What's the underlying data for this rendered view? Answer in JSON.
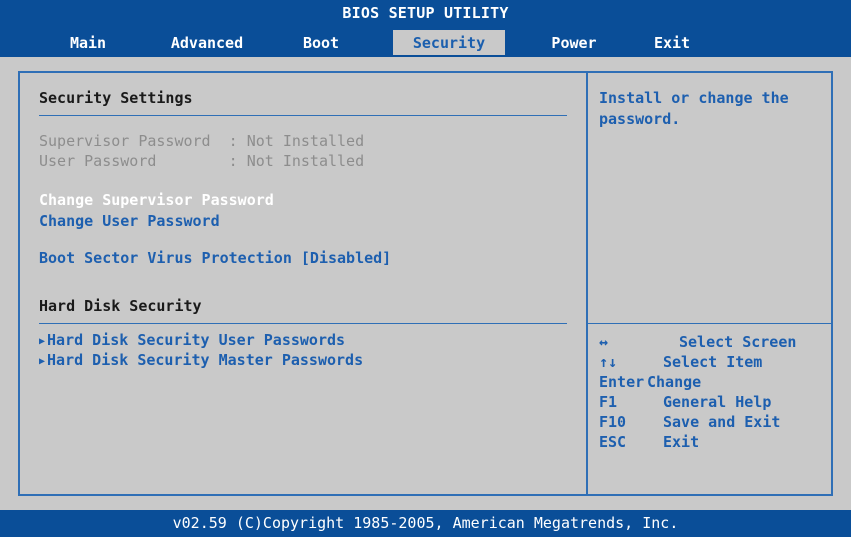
{
  "title": "BIOS SETUP UTILITY",
  "tabs": [
    "Main",
    "Advanced",
    "Boot",
    "Security",
    "Power",
    "Exit"
  ],
  "active_tab": "Security",
  "left": {
    "section1_title": "Security Settings",
    "supervisor_password": "Supervisor Password  : Not Installed",
    "user_password": "User Password        : Not Installed",
    "change_supervisor": "Change Supervisor Password",
    "change_user": "Change User Password",
    "boot_sector": "Boot Sector Virus Protection [Disabled]",
    "section2_title": "Hard Disk Security",
    "hd_user": "Hard Disk Security User Passwords",
    "hd_master": "Hard Disk Security Master Passwords",
    "submenu_arrow": "▶"
  },
  "help": {
    "line1": "Install or change the",
    "line2": "password."
  },
  "keys": [
    {
      "key": "↔",
      "action": "Select Screen"
    },
    {
      "key": "↑↓",
      "action": "Select Item"
    },
    {
      "key": "Enter",
      "action": "Change"
    },
    {
      "key": "F1",
      "action": "General Help"
    },
    {
      "key": "F10",
      "action": "Save and Exit"
    },
    {
      "key": "ESC",
      "action": "Exit"
    }
  ],
  "footer": "v02.59 (C)Copyright 1985-2005, American Megatrends, Inc.",
  "colors": {
    "bar": "#0a4e98",
    "background": "#c9c9c9",
    "highlight_text": "#1d5faf",
    "selected_text": "#ffffff",
    "disabled_text": "#8d8d8d"
  }
}
